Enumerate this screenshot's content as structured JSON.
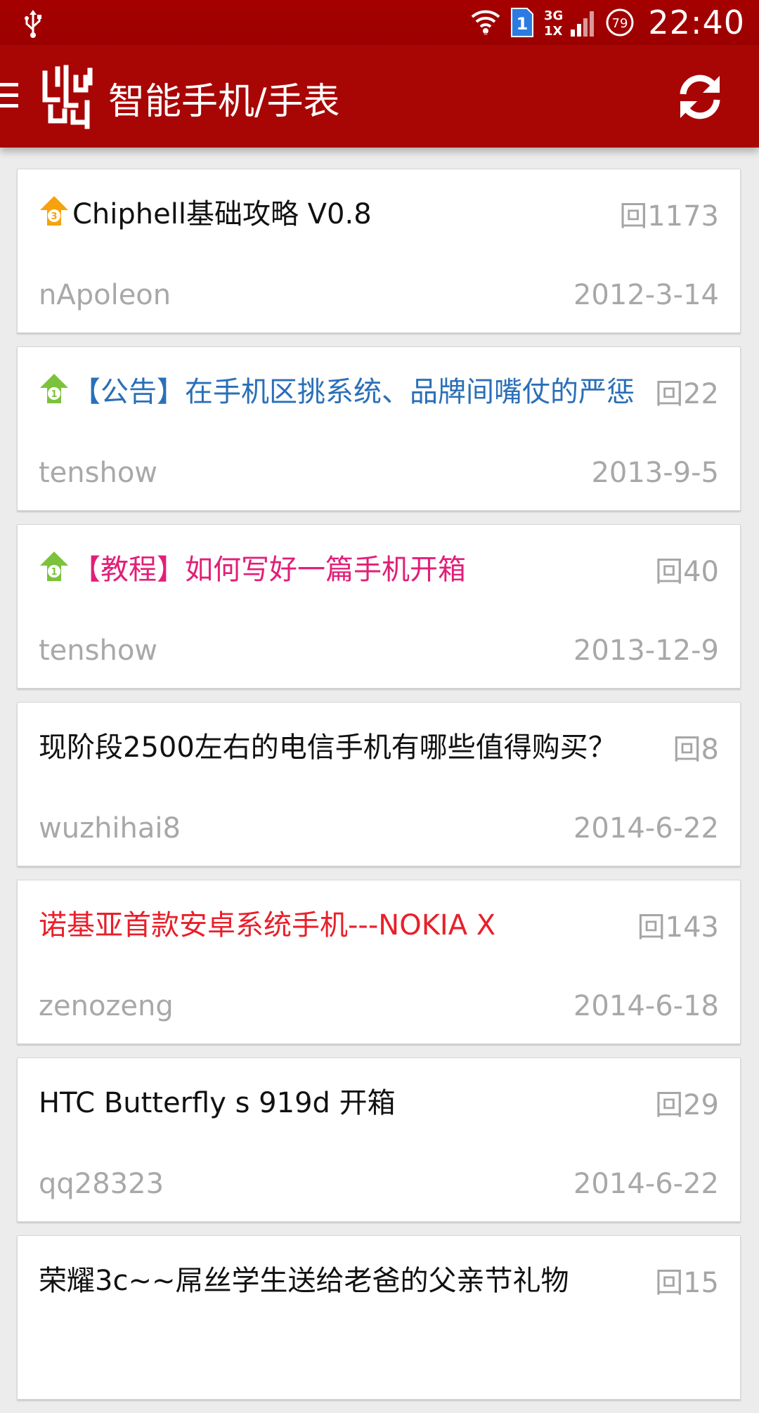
{
  "status_bar": {
    "time": "22:40",
    "battery": "79",
    "sim_slot": "1",
    "network": "3G",
    "network_sub": "1X",
    "icons": [
      "usb-icon",
      "wifi-icon",
      "sim-icon",
      "signal-icon",
      "battery-icon"
    ]
  },
  "header": {
    "title": "智能手机/手表",
    "icons": [
      "menu-icon",
      "chiphell-logo",
      "refresh-icon"
    ]
  },
  "threads": [
    {
      "badge": "3",
      "title": "Chiphell基础攻略 V0.8",
      "replies": "回1173",
      "author": "nApoleon",
      "date": "2012-3-14"
    },
    {
      "badge": "1",
      "title": "【公告】在手机区挑系统、品牌间嘴仗的严惩",
      "replies": "回22",
      "author": "tenshow",
      "date": "2013-9-5"
    },
    {
      "badge": "1",
      "title": "【教程】如何写好一篇手机开箱",
      "replies": "回40",
      "author": "tenshow",
      "date": "2013-12-9"
    },
    {
      "title": "现阶段2500左右的电信手机有哪些值得购买？",
      "replies": "回8",
      "author": "wuzhihai8",
      "date": "2014-6-22"
    },
    {
      "title": "诺基亚首款安卓系统手机---NOKIA X",
      "replies": "回143",
      "author": "zenozeng",
      "date": "2014-6-18"
    },
    {
      "title": "HTC Butterfly s 919d 开箱",
      "replies": "回29",
      "author": "qq28323",
      "date": "2014-6-22"
    },
    {
      "title": "荣耀3c~~屌丝学生送给老爸的父亲节礼物",
      "replies": "回15",
      "author": "",
      "date": ""
    }
  ],
  "colors": {
    "header_red": "#a80505",
    "badge_orange": "#f5a20c",
    "badge_green": "#7cc23c",
    "announce_blue": "#2a6fb8",
    "tutorial_pink": "#e21f78",
    "highlight_red": "#e8202a"
  }
}
